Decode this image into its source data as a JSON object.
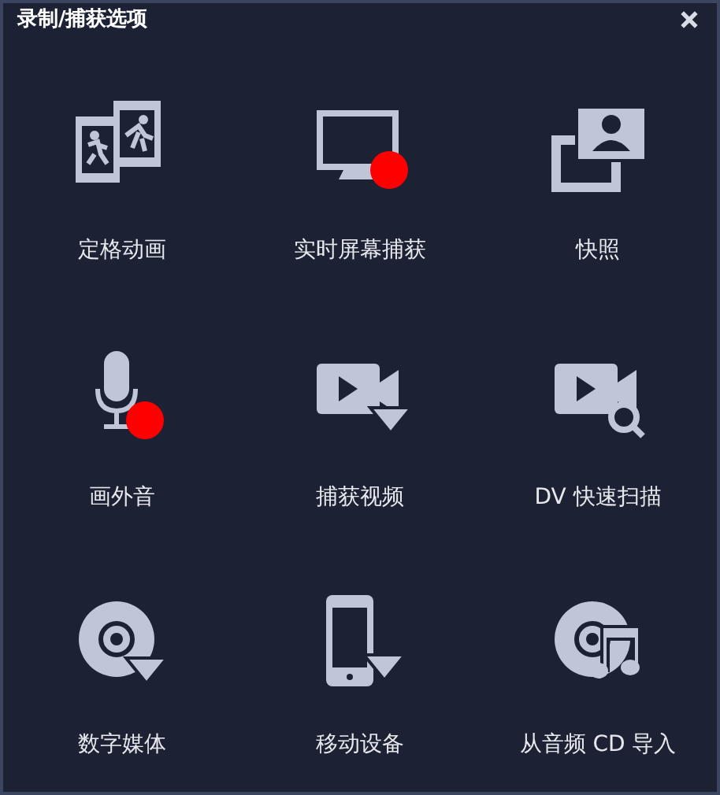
{
  "window": {
    "title": "录制/捕获选项"
  },
  "items": [
    {
      "kind": "stopmotion",
      "label": "定格动画"
    },
    {
      "kind": "screen",
      "label": "实时屏幕捕获"
    },
    {
      "kind": "snapshot",
      "label": "快照"
    },
    {
      "kind": "voiceover",
      "label": "画外音"
    },
    {
      "kind": "capture",
      "label": "捕获视频"
    },
    {
      "kind": "dvscan",
      "label": "DV 快速扫描"
    },
    {
      "kind": "disc",
      "label": "数字媒体"
    },
    {
      "kind": "mobile",
      "label": "移动设备"
    },
    {
      "kind": "audiocd",
      "label": "从音频 CD 导入"
    }
  ]
}
